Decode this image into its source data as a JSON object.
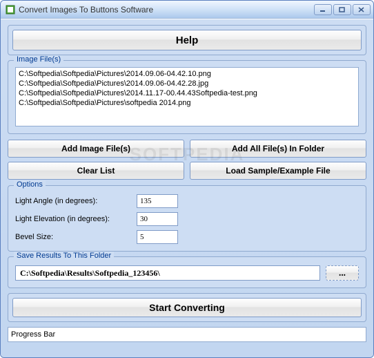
{
  "window": {
    "title": "Convert Images To Buttons Software"
  },
  "help": {
    "label": "Help"
  },
  "filelist": {
    "legend": "Image File(s)",
    "items": [
      "C:\\Softpedia\\Softpedia\\Pictures\\2014.09.06-04.42.10.png",
      "C:\\Softpedia\\Softpedia\\Pictures\\2014.09.06-04.42.28.jpg",
      "C:\\Softpedia\\Softpedia\\Pictures\\2014.11.17-00.44.43Softpedia-test.png",
      "C:\\Softpedia\\Softpedia\\Pictures\\softpedia 2014.png"
    ]
  },
  "buttons": {
    "add_files": "Add Image File(s)",
    "add_folder": "Add All File(s) In Folder",
    "clear": "Clear List",
    "load_sample": "Load Sample/Example File",
    "browse": "...",
    "start": "Start Converting"
  },
  "options": {
    "legend": "Options",
    "light_angle_label": "Light Angle (in degrees):",
    "light_angle_value": "135",
    "light_elev_label": "Light Elevation (in degrees):",
    "light_elev_value": "30",
    "bevel_label": "Bevel Size:",
    "bevel_value": "5"
  },
  "save": {
    "legend": "Save Results To This Folder",
    "path": "C:\\Softpedia\\Results\\Softpedia_123456\\"
  },
  "progress": {
    "label": "Progress Bar"
  },
  "watermark": "SOFTPEDIA"
}
